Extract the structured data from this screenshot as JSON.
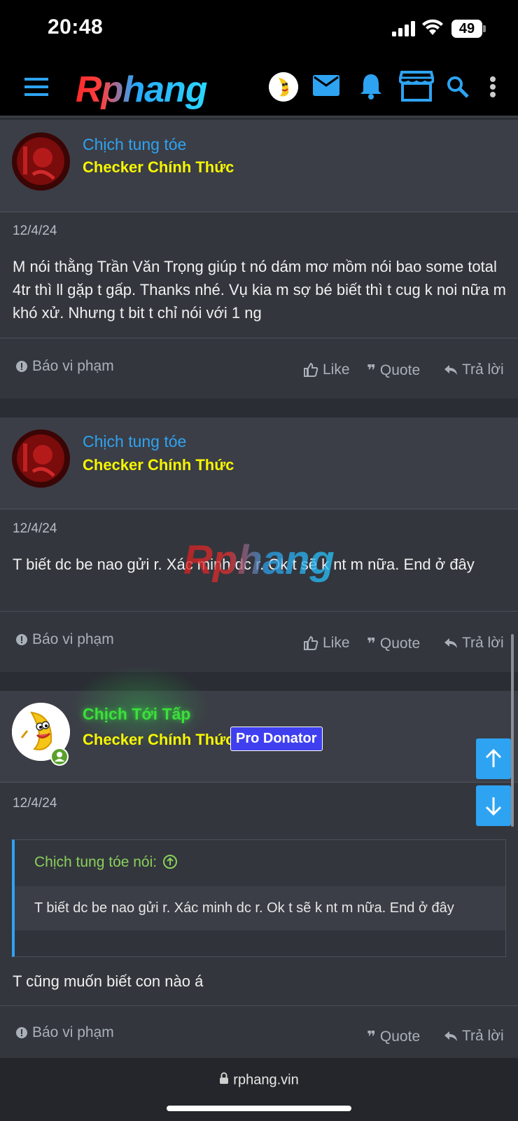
{
  "status_bar": {
    "time": "20:48",
    "battery": "49"
  },
  "nav": {
    "logo": "Rphang"
  },
  "watermark": "Rphang",
  "posts": [
    {
      "username": "Chịch tung tóe",
      "user_title": "Checker Chính Thức",
      "date": "12/4/24",
      "message": "M nói thằng Trần Văn Trọng giúp t nó dám mơ mồm nói bao some total 4tr thì ll gặp t gấp. Thanks nhé. Vụ kia m sợ bé biết thì t cug k noi nữa m khó xử. Nhưng t bit t chỉ nói với 1 ng",
      "actions": {
        "report": "Báo vi phạm",
        "like": "Like",
        "quote": "Quote",
        "reply": "Trả lời"
      }
    },
    {
      "username": "Chịch tung tóe",
      "user_title": "Checker Chính Thức",
      "date": "12/4/24",
      "message": "T biết dc be nao gửi r. Xác minh dc r. Ok t sẽ k nt m nữa. End ở đây",
      "actions": {
        "report": "Báo vi phạm",
        "like": "Like",
        "quote": "Quote",
        "reply": "Trả lời"
      }
    },
    {
      "username": "Chịch Tới Tấp",
      "user_title": "Checker Chính Thức",
      "badge": "Pro Donator",
      "date": "12/4/24",
      "quote_author": "Chịch tung tóe nói:",
      "quote_text": "T biết dc be nao gửi r. Xác minh dc r. Ok t sẽ k nt m nữa. End ở đây",
      "message": "T cũng muốn biết con nào á",
      "actions": {
        "report": "Báo vi phạm",
        "quote": "Quote",
        "reply": "Trả lời"
      }
    }
  ],
  "browser": {
    "url": "rphang.vin"
  },
  "colors": {
    "accent": "#2ea3f2",
    "user_title": "#f6f600",
    "online_username": "#3be03b",
    "badge": "#3f3ff0",
    "quote_author": "#8ad05a"
  }
}
